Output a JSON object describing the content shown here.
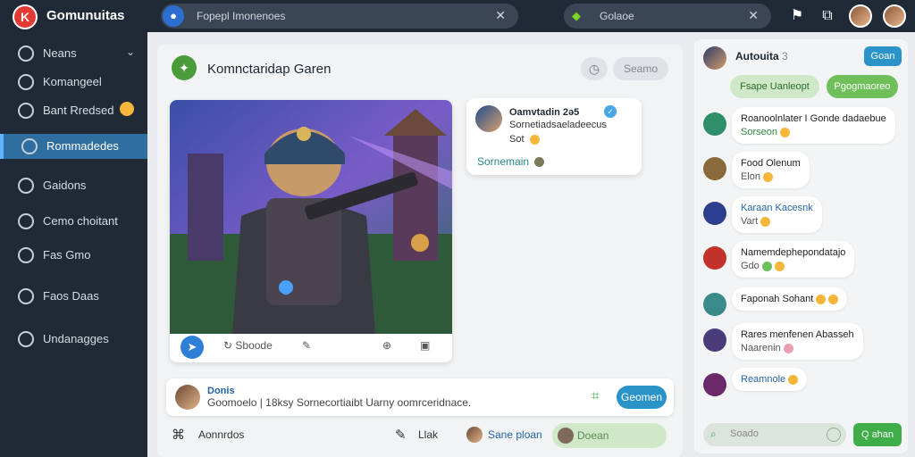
{
  "app": {
    "title": "Gomunuitas",
    "logo_glyph": "K"
  },
  "search": {
    "placeholder": "Fopepl Imonenoes",
    "secondary_placeholder": "Golaoe"
  },
  "sidebar": {
    "items": [
      {
        "label": "Neans",
        "icon": "leaf-icon",
        "chevron": "⌄"
      },
      {
        "label": "Komangeel",
        "icon": "feed-icon"
      },
      {
        "label": "Bant Rredsed",
        "icon": "bookmark-icon",
        "emoji": true
      },
      {
        "label": "Rommadedes",
        "icon": "inbox-icon",
        "active": true
      },
      {
        "label": "Gaidons",
        "icon": "globe-icon"
      },
      {
        "label": "Cemo choitant",
        "icon": "chat-icon"
      },
      {
        "label": "Fas Gmo",
        "icon": "person-icon"
      },
      {
        "label": "Faos Daas",
        "icon": "message-icon"
      },
      {
        "label": "Undanagges",
        "icon": "settings-icon"
      }
    ]
  },
  "main": {
    "title": "Komnctaridap Garen",
    "header_button": "Seamo",
    "post": {
      "actions": {
        "share_label": "Sboode"
      }
    },
    "comment": {
      "name": "Oamvtadin 2ə5",
      "line1": "Sornetiadsaeladeecus",
      "line2": "Sot",
      "link": "Sornemain"
    },
    "composer": {
      "name": "Donis",
      "text": "Goomoelo | 18ksy Sornecortiaibt Uarny oomrceridnace.",
      "button": "Geomen"
    },
    "bottom": {
      "left_label": "Aonnrdos",
      "action_label": "Llak",
      "user_label": "Sane ploan",
      "pill_label": "Doean"
    }
  },
  "right": {
    "title": "Autouita",
    "title_badge": "3",
    "top_button": "Goan",
    "chips": [
      "Fsape Uanleopt",
      "Pgogmaoreo"
    ],
    "messages": [
      {
        "line1": "Roanoolnlater I Gonde dadaebue",
        "line2": "Sorseon",
        "l2_style": "green",
        "avatar": "#2f8f6a"
      },
      {
        "line1": "Food Olenum",
        "line2": "Elon",
        "l1_style": "blue-tail",
        "avatar": "#8a6a3a"
      },
      {
        "line1": "Karaan Kacesnk",
        "line2": "Vart",
        "l1_style": "blue",
        "avatar": "#2c3f8c"
      },
      {
        "line1": "Namemdephepondatajo",
        "line2": "Gdo",
        "avatar": "#c2312a"
      },
      {
        "line1": "Faponah Sohant",
        "line2": "",
        "l1_style": "green-tail",
        "avatar": "#3a8a8a"
      },
      {
        "line1": "Rares menfenen Abasseh",
        "line2": "Naarenin",
        "avatar": "#4a3c7a"
      },
      {
        "line1": "Reamnole",
        "line2": "",
        "l1_style": "blue",
        "avatar": "#6a2a6a"
      }
    ],
    "input_placeholder": "Soado",
    "send_button": "Q ahan"
  }
}
